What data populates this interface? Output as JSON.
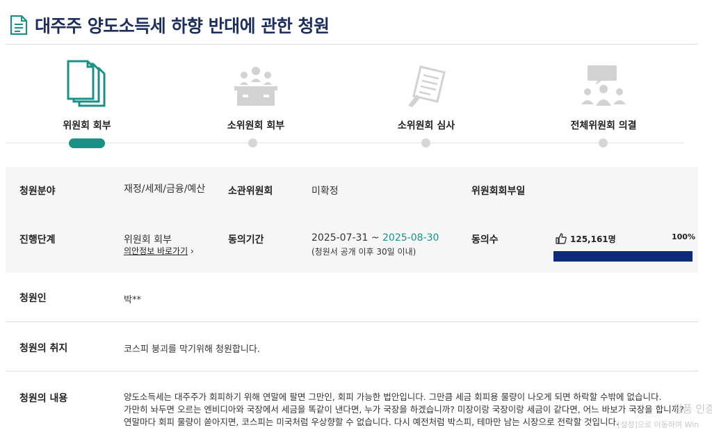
{
  "page": {
    "title": "대주주 양도소득세 하향 반대에 관한 청원"
  },
  "steps": [
    {
      "label": "위원회 회부",
      "icon": "documents-icon",
      "active": true
    },
    {
      "label": "소위원회 회부",
      "icon": "meeting-table-icon",
      "active": false
    },
    {
      "label": "소위원회 심사",
      "icon": "review-document-icon",
      "active": false
    },
    {
      "label": "전체위원회 의결",
      "icon": "discussion-icon",
      "active": false
    }
  ],
  "info": {
    "field_label": "청원분야",
    "field_value": "재정/세제/금융/예산",
    "committee_label": "소관위원회",
    "committee_value": "미확정",
    "referral_date_label": "위원회회부일",
    "referral_date_value": "",
    "stage_label": "진행단계",
    "stage_value": "위원회 회부",
    "stage_link": "의안정보 바로가기",
    "period_label": "동의기간",
    "period_start": "2025-07-31",
    "period_sep": " ~ ",
    "period_end": "2025-08-30",
    "period_note": "(청원서 공개 이후 30일 이내)",
    "agree_label": "동의수",
    "agree_count": "125,161명",
    "agree_percent": "100%",
    "agree_fraction": 1.0
  },
  "petitioner": {
    "label": "청원인",
    "value": "박**"
  },
  "purpose": {
    "label": "청원의 취지",
    "value": "코스피 붕괴를 막기위해 청원합니다."
  },
  "content": {
    "label": "청원의 내용",
    "lines": [
      "양도소득세는 대주주가 회피하기 위해 연말에 팔면 그만인, 회피 가능한 법안입니다. 그만큼 세금 회피용 물량이 나오게 되면 하락할 수밖에 없습니다.",
      "가만히 놔두면 오르는 엔비디아와 국장에서 세금을 똑같이 낸다면, 누가 국장을 하겠습니까? 미장이랑 국장이랑 세금이 같다면, 어느 바보가 국장을 합니까?",
      "연말마다 회피 물량이 쏟아지면, 코스피는 미국처럼 우상향할 수 없습니다. 다시 예전처럼 박스피, 테마만 남는 시장으로 전락할 것입니다."
    ]
  },
  "overlay": {
    "line1": "정품 인증",
    "line2": "[설정]으로 이동하여 Win"
  },
  "colors": {
    "accent": "#1c8f87",
    "title": "#1f2f5c",
    "progress": "#0f2a78"
  }
}
